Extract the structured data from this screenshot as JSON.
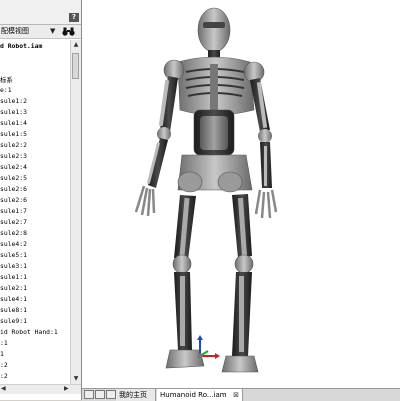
{
  "left_panel": {
    "help_label": "?",
    "view_label": "配模视图",
    "dropdown_label": "▼",
    "tree_items": [
      {
        "label": "d Robot.iam",
        "bold": true
      },
      {
        "label": "",
        "bold": false
      },
      {
        "label": "",
        "bold": false
      },
      {
        "label": "标系",
        "bold": false
      },
      {
        "label": "e:1",
        "bold": false
      },
      {
        "label": "sule1:2",
        "bold": false
      },
      {
        "label": "sule1:3",
        "bold": false
      },
      {
        "label": "sule1:4",
        "bold": false
      },
      {
        "label": "sule1:5",
        "bold": false
      },
      {
        "label": "sule2:2",
        "bold": false
      },
      {
        "label": "sule2:3",
        "bold": false
      },
      {
        "label": "sule2:4",
        "bold": false
      },
      {
        "label": "sule2:5",
        "bold": false
      },
      {
        "label": "sule2:6",
        "bold": false
      },
      {
        "label": "sule2:6",
        "bold": false
      },
      {
        "label": "sule1:7",
        "bold": false
      },
      {
        "label": "sule2:7",
        "bold": false
      },
      {
        "label": "sule2:8",
        "bold": false
      },
      {
        "label": "sule4:2",
        "bold": false
      },
      {
        "label": "sule5:1",
        "bold": false
      },
      {
        "label": "sule3:1",
        "bold": false
      },
      {
        "label": "sule1:1",
        "bold": false
      },
      {
        "label": "sule2:1",
        "bold": false
      },
      {
        "label": "sule4:1",
        "bold": false
      },
      {
        "label": "sule8:1",
        "bold": false
      },
      {
        "label": "sule9:1",
        "bold": false
      },
      {
        "label": "id Robot Hand:1",
        "bold": false
      },
      {
        "label": ":1",
        "bold": false
      },
      {
        "label": "1",
        "bold": false
      },
      {
        "label": ":2",
        "bold": false
      },
      {
        "label": ":2",
        "bold": false
      }
    ]
  },
  "tabs": {
    "home_label": "我的主页",
    "doc_label": "Humanoid Ro...iam",
    "close_label": "⊠"
  },
  "colors": {
    "viewport_bg": "#ffffff",
    "robot_metal": "#9a9a9a",
    "robot_dark": "#2a2a2a",
    "axis_x": "#cc2222",
    "axis_y": "#22aa22",
    "axis_z": "#2244cc"
  },
  "icons": [
    "help-icon",
    "binocular-icon",
    "scroll-up-icon",
    "scroll-down-icon",
    "robot-model",
    "axis-triad-icon",
    "tab-close-icon"
  ]
}
